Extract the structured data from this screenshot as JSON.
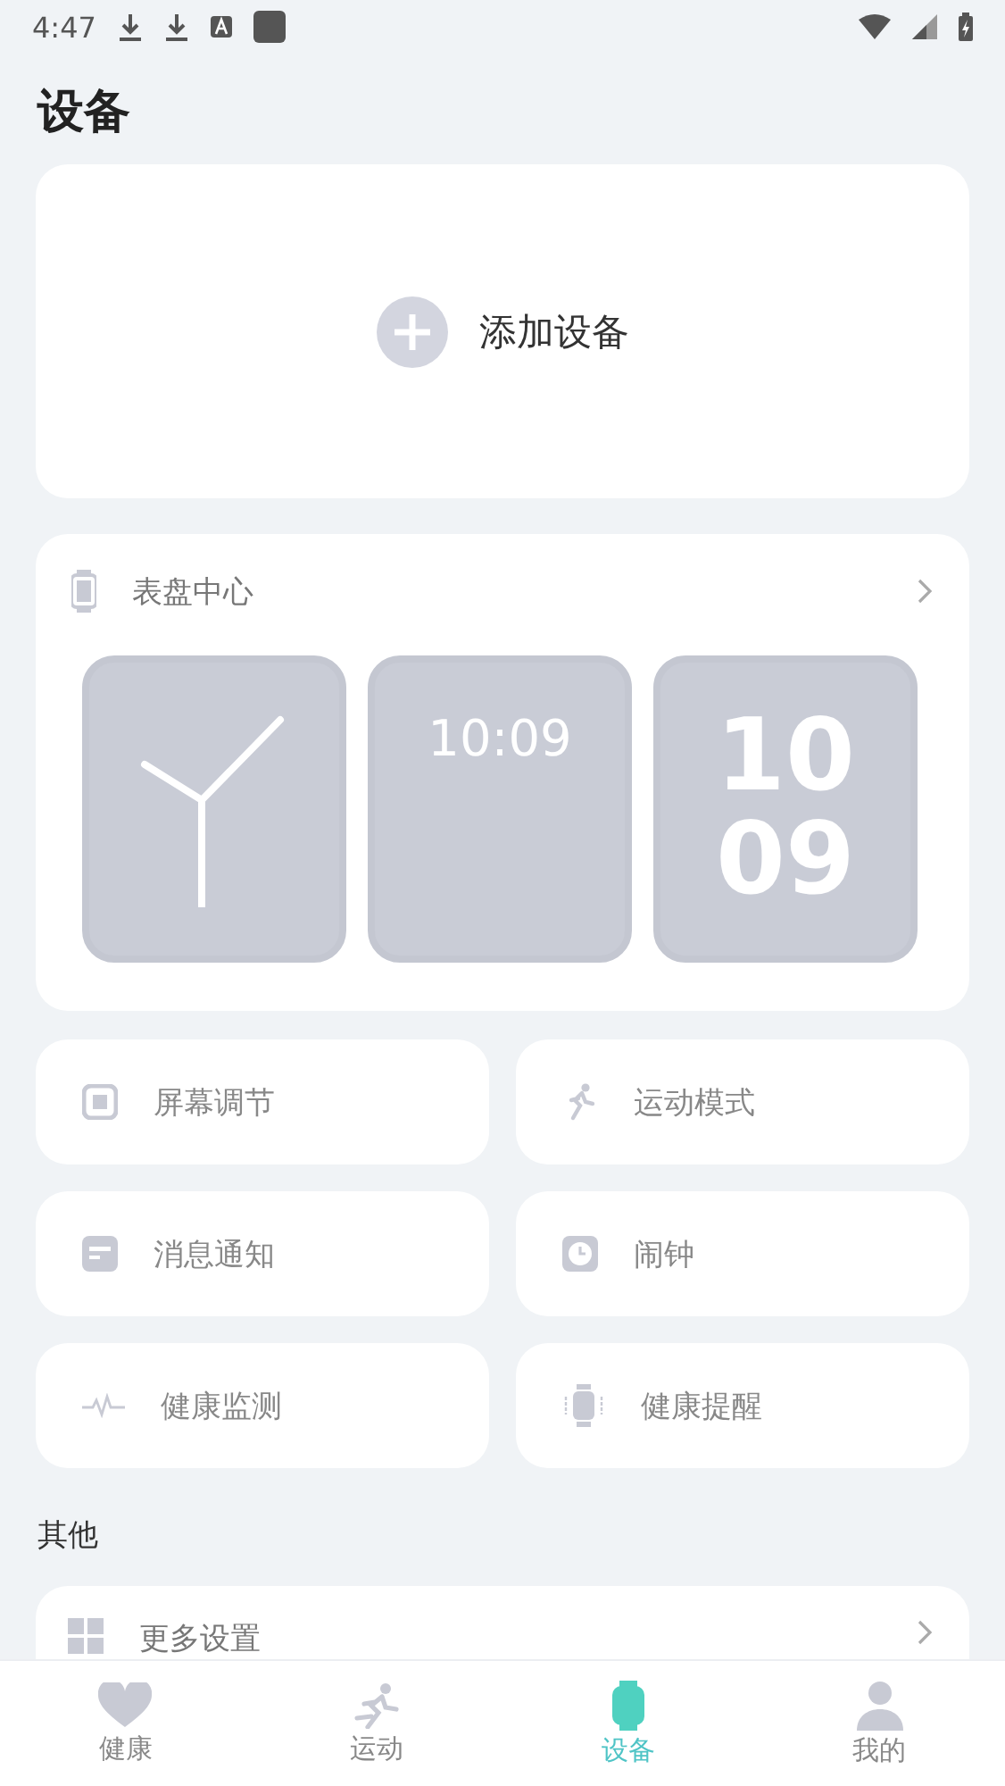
{
  "status_bar": {
    "time": "4:47"
  },
  "title": "设备",
  "add_device": {
    "label": "添加设备"
  },
  "watch_faces": {
    "title": "表盘中心",
    "faces": [
      {
        "kind": "analog"
      },
      {
        "kind": "digital",
        "time": "10:09"
      },
      {
        "kind": "big",
        "hour": "10",
        "minute": "09"
      }
    ]
  },
  "features": [
    {
      "kind": "screen",
      "label": "屏幕调节"
    },
    {
      "kind": "sport",
      "label": "运动模式"
    },
    {
      "kind": "message",
      "label": "消息通知"
    },
    {
      "kind": "alarm",
      "label": "闹钟"
    },
    {
      "kind": "pulse",
      "label": "健康监测"
    },
    {
      "kind": "vibrate",
      "label": "健康提醒"
    }
  ],
  "other": {
    "heading": "其他",
    "items": [
      {
        "label": "更多设置"
      }
    ]
  },
  "tabs": [
    {
      "kind": "health",
      "label": "健康",
      "selected": false
    },
    {
      "kind": "sport",
      "label": "运动",
      "selected": false
    },
    {
      "kind": "device",
      "label": "设备",
      "selected": true
    },
    {
      "kind": "me",
      "label": "我的",
      "selected": false
    }
  ]
}
